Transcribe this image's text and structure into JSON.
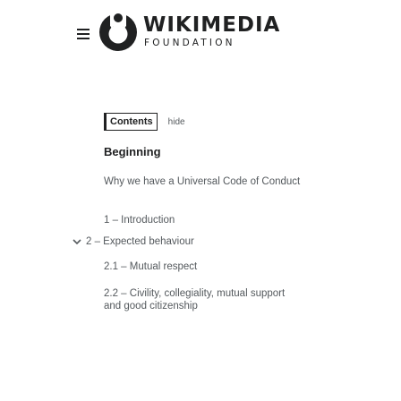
{
  "header": {
    "logo_text": "WIKIMEDIA",
    "logo_subtext": "FOUNDATION"
  },
  "toc": {
    "contents_label": "Contents",
    "hide_label": "hide",
    "items": [
      {
        "label": "Beginning"
      },
      {
        "label": "Why we have a Universal Code of Conduct"
      },
      {
        "label": "1 – Introduction"
      },
      {
        "label": "2 – Expected behaviour"
      },
      {
        "label": "2.1 – Mutual respect"
      },
      {
        "label": "2.2 – Civility, collegiality, mutual support and good citizenship"
      }
    ]
  },
  "icons": {
    "menu": "hamburger-menu-icon",
    "logo": "wikimedia-logo-icon",
    "expand": "chevron-down-icon"
  },
  "colors": {
    "text": "#202122",
    "muted_text": "#54595d",
    "background": "#ffffff"
  }
}
